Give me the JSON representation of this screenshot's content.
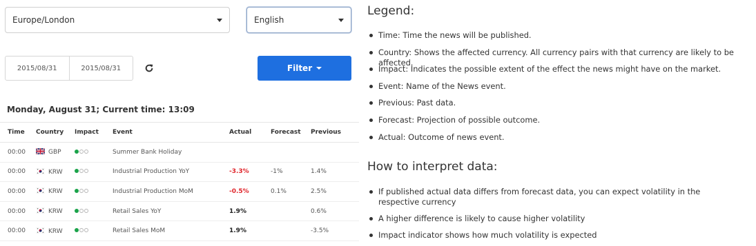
{
  "selectors": {
    "timezone": "Europe/London",
    "language": "English"
  },
  "date_range": {
    "from": "2015/08/31",
    "to": "2015/08/31"
  },
  "filter_label": "Filter",
  "current_time_text": "Monday, August 31; Current time: 13:09",
  "table": {
    "headers": [
      "Time",
      "Country",
      "Impact",
      "Event",
      "Actual",
      "Forecast",
      "Previous"
    ],
    "rows": [
      {
        "time": "00:00",
        "currency": "GBP",
        "flag": "uk",
        "impact": 1,
        "event": "Summer Bank Holiday",
        "actual": "",
        "forecast": "",
        "previous": ""
      },
      {
        "time": "00:00",
        "currency": "KRW",
        "flag": "kr",
        "impact": 1,
        "event": "Industrial Production YoY",
        "actual": "-3.3%",
        "forecast": "-1%",
        "previous": "1.4%"
      },
      {
        "time": "00:00",
        "currency": "KRW",
        "flag": "kr",
        "impact": 1,
        "event": "Industrial Production MoM",
        "actual": "-0.5%",
        "forecast": "0.1%",
        "previous": "2.5%"
      },
      {
        "time": "00:00",
        "currency": "KRW",
        "flag": "kr",
        "impact": 1,
        "event": "Retail Sales YoY",
        "actual": "1.9%",
        "forecast": "",
        "previous": "0.6%"
      },
      {
        "time": "00:00",
        "currency": "KRW",
        "flag": "kr",
        "impact": 1,
        "event": "Retail Sales MoM",
        "actual": "1.9%",
        "forecast": "",
        "previous": "-3.5%"
      }
    ]
  },
  "legend": {
    "title": "Legend:",
    "items": [
      "Time: Time the news will be published.",
      "Country: Shows the affected currency. All currency pairs with that currency are likely to be affected.",
      "Impact: Indicates the possible extent of the effect the news might have on the market.",
      "Event: Name of the News event.",
      "Previous: Past data.",
      "Forecast: Projection of possible outcome.",
      "Actual: Outcome of news event."
    ]
  },
  "interpret": {
    "title": "How to interpret data:",
    "items": [
      "If published actual data differs from forecast data, you can expect volatility in the respective currency",
      "A higher difference is likely to cause higher volatility",
      "Impact indicator shows how much volatility is expected"
    ]
  },
  "colors": {
    "accent": "#1e6fe0",
    "negative": "#e0262c",
    "impact_on": "#1aa34a"
  },
  "icons": {
    "refresh": "refresh-icon",
    "dropdown": "chevron-down-icon"
  }
}
